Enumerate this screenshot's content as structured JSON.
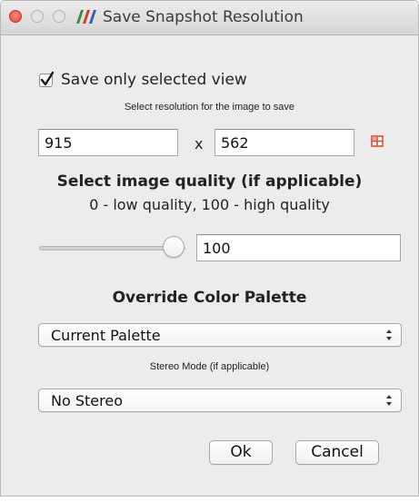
{
  "window": {
    "title": "Save Snapshot Resolution"
  },
  "save_only_selected": {
    "label": "Save only selected view",
    "checked": true
  },
  "resolution": {
    "label": "Select resolution for the image to save",
    "width": "915",
    "separator": "x",
    "height": "562",
    "lock_icon": "aspect-lock-icon"
  },
  "quality": {
    "heading": "Select image quality (if applicable)",
    "description": "0 - low quality, 100 - high quality",
    "value": "100",
    "slider_fraction": 1.0
  },
  "palette": {
    "heading": "Override Color Palette",
    "selected": "Current Palette"
  },
  "stereo": {
    "label": "Stereo Mode (if applicable)",
    "selected": "No Stereo"
  },
  "buttons": {
    "ok": "Ok",
    "cancel": "Cancel"
  },
  "colors": {
    "close_button": "#e0443a",
    "lock_icon": "#d9503a"
  }
}
